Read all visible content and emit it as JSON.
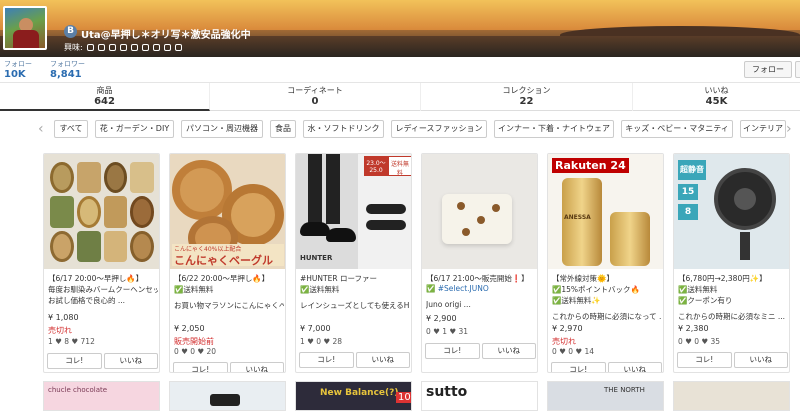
{
  "profile": {
    "badge": "B",
    "name": "Uta@早押し＊オリ写＊激安品強化中",
    "interest_label": "興味:",
    "followers_label": "フォロー",
    "followers": "10K",
    "following_label": "フォロワー",
    "following": "8,841",
    "follow_button": "フォロー"
  },
  "tabs": [
    {
      "label": "商品",
      "count": "642"
    },
    {
      "label": "コーディネート",
      "count": "0"
    },
    {
      "label": "コレクション",
      "count": "22"
    },
    {
      "label": "いいね",
      "count": "45K"
    }
  ],
  "categories": [
    "すべて",
    "花・ガーデン・DIY",
    "パソコン・周辺機器",
    "食品",
    "水・ソフトドリンク",
    "レディースファッション",
    "インナー・下着・ナイトウェア",
    "キッズ・ベビー・マタニティ",
    "インテリア"
  ],
  "cards": [
    {
      "line1": "【6/17 20:00〜早押し🔥】",
      "line2": "毎度お馴染みバームクーヘンセット",
      "line3": "お試し価格で良心的 ...",
      "price": "¥ 1,080",
      "status": "売切れ",
      "meta": "1  ♥ 8  ♥ 712",
      "kore": "コレ!",
      "iine": "いいね"
    },
    {
      "line1": "【6/22 20:00〜早押し🔥】",
      "line2": "✅送料無料",
      "line3": "お買い物マラソンにこんにゃくベーグルが登 ...",
      "price": "¥ 2,050",
      "status": "販売開始前",
      "meta": "0  ♥ 0  ♥ 20",
      "kore": "コレ!",
      "iine": "いいね"
    },
    {
      "line1": "#HUNTER ローファー",
      "line2": "✅送料無料",
      "line3": "レインシューズとしても使えるHUNTERのロー ...",
      "price": "¥ 7,000",
      "status": "",
      "meta": "1  ♥ 0  ♥ 28",
      "kore": "コレ!",
      "iine": "いいね"
    },
    {
      "line1": "【6/17 21:00〜販売開始❗️】",
      "line2": "✅ #Select.JUNO",
      "line3": "Juno origi ...",
      "price": "¥ 2,900",
      "status": "",
      "meta": "0  ♥ 1  ♥ 31",
      "kore": "コレ!",
      "iine": "いいね"
    },
    {
      "line1": "【常外線対策🌞】",
      "line2": "✅15%ポイントバック🔥",
      "line3": "✅送料無料✨",
      "line4": "これからの時期に必須になって ...",
      "price": "¥ 2,970",
      "status": "売切れ",
      "meta": "0  ♥ 0  ♥ 14",
      "kore": "コレ!",
      "iine": "いいね"
    },
    {
      "line1": "【6,780円→2,380円✨】",
      "line2": "✅送料無料",
      "line3": "✅クーポン有り",
      "line4": "これからの時期に必須なミニ ...",
      "price": "¥ 2,380",
      "status": "",
      "meta": "0  ♥ 0  ♥ 35",
      "kore": "コレ!",
      "iine": "いいね"
    }
  ],
  "image_text": {
    "bagel_top": "こんにゃく40%以上配合",
    "bagel": "こんにゃくベーグル",
    "hunter_size": "23.0〜25.0",
    "hunter_tag": "送料無料",
    "hunter_brand": "HUNTER",
    "rakuten": "Rakuten 24",
    "anessa": "ANESSA",
    "fan_big": "超静音",
    "fan_num1": "15",
    "fan_num2": "8",
    "bottom1": "chucle chocolate",
    "bottom3": "New Balance(?)",
    "bottom3b": "10",
    "bottom4": "sutto",
    "bottom5": "THE NORTH"
  }
}
